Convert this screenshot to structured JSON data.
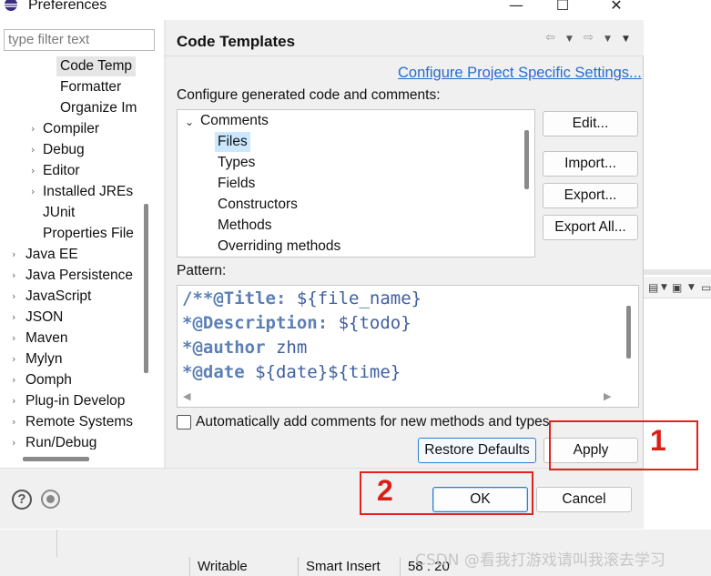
{
  "window": {
    "title": "Preferences",
    "title_icon": "eclipse-icon",
    "maximize_glyph": "☐",
    "close_glyph": "✕",
    "minimize_glyph": "—"
  },
  "sidebar": {
    "filter_placeholder": "type filter text",
    "items": [
      {
        "label": "Code Temp",
        "selected": true,
        "expandable": false
      },
      {
        "label": "Formatter",
        "expandable": false
      },
      {
        "label": "Organize Im",
        "expandable": false
      },
      {
        "label": "Compiler",
        "expandable": true
      },
      {
        "label": "Debug",
        "expandable": true
      },
      {
        "label": "Editor",
        "expandable": true
      },
      {
        "label": "Installed JREs",
        "expandable": true
      },
      {
        "label": "JUnit",
        "expandable": false
      },
      {
        "label": "Properties File",
        "expandable": false
      },
      {
        "label": "Java EE",
        "expandable": true
      },
      {
        "label": "Java Persistence",
        "expandable": true
      },
      {
        "label": "JavaScript",
        "expandable": true
      },
      {
        "label": "JSON",
        "expandable": true
      },
      {
        "label": "Maven",
        "expandable": true
      },
      {
        "label": "Mylyn",
        "expandable": true
      },
      {
        "label": "Oomph",
        "expandable": true
      },
      {
        "label": "Plug-in Develop",
        "expandable": true
      },
      {
        "label": "Remote Systems",
        "expandable": true
      },
      {
        "label": "Run/Debug",
        "expandable": true
      }
    ]
  },
  "page": {
    "title": "Code Templates",
    "project_link": "Configure Project Specific Settings...",
    "description": "Configure generated code and comments:",
    "templates": {
      "group": "Comments",
      "items": [
        "Files",
        "Types",
        "Fields",
        "Constructors",
        "Methods",
        "Overriding methods"
      ],
      "selected": "Files"
    },
    "side_buttons": {
      "edit": "Edit...",
      "import": "Import...",
      "export": "Export...",
      "export_all": "Export All..."
    },
    "pattern_label": "Pattern:",
    "pattern_lines": [
      {
        "comment": "/**@Title:",
        "value": " ${file_name}"
      },
      {
        "comment": "*@Description:",
        "value": " ${todo}"
      },
      {
        "comment": "*@author",
        "value": " zhm"
      },
      {
        "comment": "*@date",
        "value": " ${date}${time}"
      }
    ],
    "auto_comment_label": "Automatically add comments for new methods and types",
    "auto_comment_checked": false,
    "restore_defaults": "Restore Defaults",
    "apply": "Apply"
  },
  "footer": {
    "ok": "OK",
    "cancel": "Cancel",
    "help_glyph": "?"
  },
  "annotations": {
    "step1": "1",
    "step2": "2"
  },
  "status_bar": {
    "writable": "Writable",
    "insert_mode": "Smart Insert",
    "position": "58 : 20"
  },
  "watermark": "CSDN @看我打游戏请叫我滚去学习"
}
